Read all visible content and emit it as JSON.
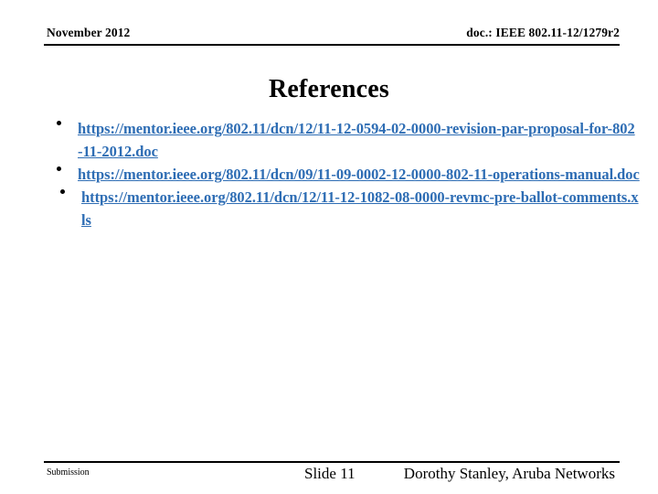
{
  "header": {
    "date": "November 2012",
    "doc_id": "doc.: IEEE 802.11-12/1279r2"
  },
  "title": "References",
  "bullets": [
    {
      "marker": "•",
      "link": "https://mentor.ieee.org/802.11/dcn/12/11-12-0594-02-0000-revision-par-proposal-for-802-11-2012.doc"
    },
    {
      "marker": "•",
      "link": "https://mentor.ieee.org/802.11/dcn/09/11-09-0002-12-0000-802-11-operations-manual.doc"
    },
    {
      "marker": "•",
      "link": "https://mentor.ieee.org/802.11/dcn/12/11-12-1082-08-0000-revmc-pre-ballot-comments.xls"
    }
  ],
  "footer": {
    "submission": "Submission",
    "slide_number": "Slide 11",
    "author": "Dorothy Stanley, Aruba Networks"
  },
  "colors": {
    "link": "#2E6DB4",
    "text": "#000000",
    "background": "#FFFFFF"
  }
}
